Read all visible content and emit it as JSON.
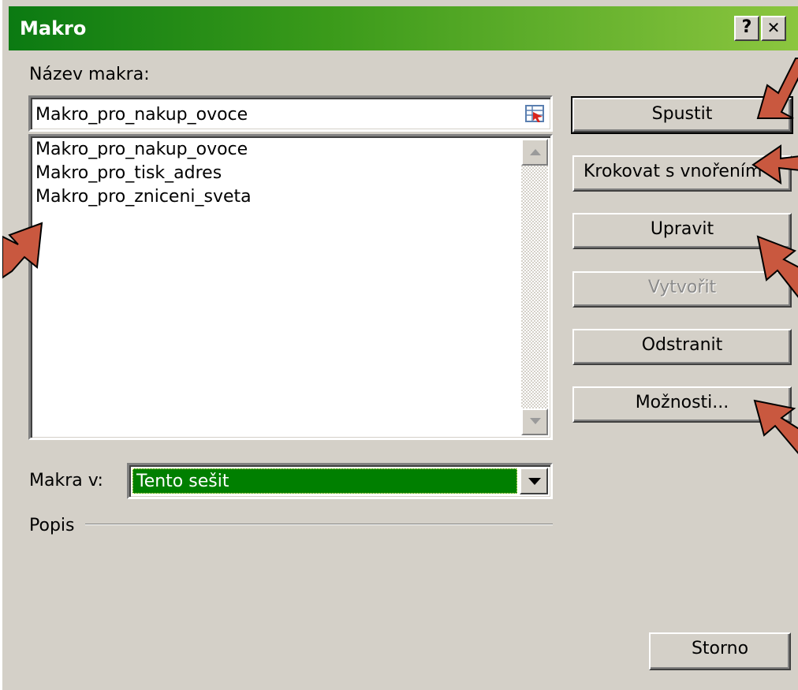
{
  "window": {
    "title": "Makro",
    "help_button": "?",
    "close_button": "✕"
  },
  "macro_name": {
    "label": "Název makra:",
    "value": "Makro_pro_nakup_ovoce"
  },
  "macro_list": {
    "items": [
      "Makro_pro_nakup_ovoce",
      "Makro_pro_tisk_adres",
      "Makro_pro_zniceni_sveta"
    ]
  },
  "buttons": {
    "run": "Spustit",
    "step_into": "Krokovat s vnořením",
    "edit": "Upravit",
    "create": "Vytvořit",
    "delete": "Odstranit",
    "options": "Možnosti...",
    "cancel": "Storno"
  },
  "macros_in": {
    "label": "Makra v:",
    "selected": "Tento sešit"
  },
  "description": {
    "label": "Popis"
  },
  "colors": {
    "title_gradient_start": "#0b7a12",
    "selection": "#007f00",
    "annotation_arrow": "#c9583f"
  }
}
